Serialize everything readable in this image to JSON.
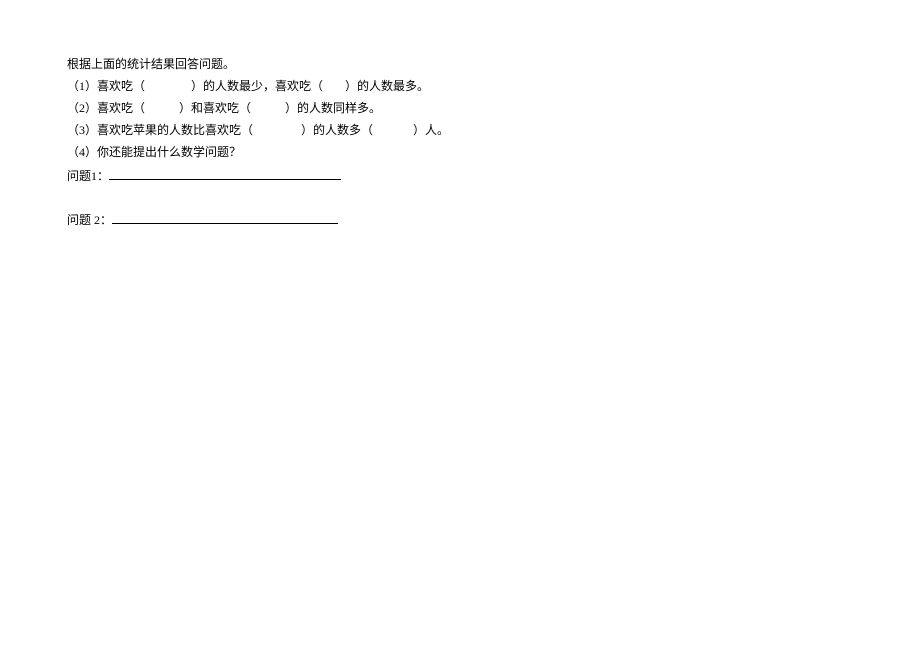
{
  "intro": "根据上面的统计结果回答问题。",
  "q1": {
    "a": "（1）喜欢吃（",
    "b": "）的人数最少，喜欢吃（",
    "c": "）的人数最多。"
  },
  "q2": {
    "a": "（2）喜欢吃（",
    "b": "）和喜欢吃（",
    "c": "）的人数同样多。"
  },
  "q3": {
    "a": "（3）喜欢吃苹果的人数比喜欢吃（",
    "b": "）的人数多（",
    "c": "）人。"
  },
  "q4": {
    "a": "（4）你还能提出什么数学问题？"
  },
  "q5": {
    "label": "问题1："
  },
  "q6": {
    "label": "问题 2："
  }
}
